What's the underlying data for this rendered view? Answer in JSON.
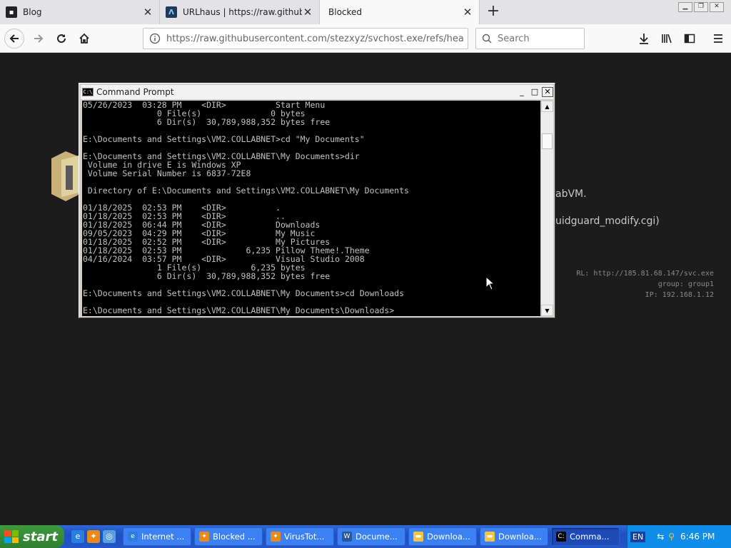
{
  "browser": {
    "tabs": [
      {
        "title": "Blog",
        "icon": "blog-favicon"
      },
      {
        "title": "URLhaus | https://raw.githubus",
        "icon": "urlhaus-favicon"
      },
      {
        "title": "Blocked",
        "icon": "none"
      }
    ],
    "url": "https://raw.githubusercontent.com/stezxyz/svchost.exe/refs/hea",
    "search_placeholder": "Search"
  },
  "page": {
    "partial_line_1": "abVM.",
    "partial_line_2": "uidguard_modify.cgi)",
    "info_url": "RL: http://185.81.68.147/svc.exe",
    "info_group": "group: group1",
    "info_ip": "IP: 192.168.1.12"
  },
  "cmd": {
    "title": "Command Prompt",
    "icon_text": "C:\\",
    "lines": [
      "05/26/2023  03:28 PM    <DIR>          Start Menu",
      "               0 File(s)              0 bytes",
      "               6 Dir(s)  30,789,988,352 bytes free",
      "",
      "E:\\Documents and Settings\\VM2.COLLABNET>cd \"My Documents\"",
      "",
      "E:\\Documents and Settings\\VM2.COLLABNET\\My Documents>dir",
      " Volume in drive E is Windows XP",
      " Volume Serial Number is 6837-72E8",
      "",
      " Directory of E:\\Documents and Settings\\VM2.COLLABNET\\My Documents",
      "",
      "01/18/2025  02:53 PM    <DIR>          .",
      "01/18/2025  02:53 PM    <DIR>          ..",
      "01/18/2025  06:44 PM    <DIR>          Downloads",
      "09/05/2023  04:29 PM    <DIR>          My Music",
      "01/18/2025  02:52 PM    <DIR>          My Pictures",
      "01/18/2025  02:53 PM             6,235 Pillow Theme!.Theme",
      "04/16/2024  03:57 PM    <DIR>          Visual Studio 2008",
      "               1 File(s)          6,235 bytes",
      "               6 Dir(s)  30,789,988,352 bytes free",
      "",
      "E:\\Documents and Settings\\VM2.COLLABNET\\My Documents>cd Downloads",
      "",
      "E:\\Documents and Settings\\VM2.COLLABNET\\My Documents\\Downloads>"
    ],
    "scroll_position": 0.12
  },
  "taskbar": {
    "start_label": "start",
    "items": [
      {
        "label": "Internet ...",
        "icon": "ie-icon",
        "active": false
      },
      {
        "label": "Blocked ...",
        "icon": "firefox-icon",
        "active": false
      },
      {
        "label": "VirusTot...",
        "icon": "firefox-icon",
        "active": false
      },
      {
        "label": "Docume...",
        "icon": "word-icon",
        "active": false
      },
      {
        "label": "Downloa...",
        "icon": "folder-icon",
        "active": false
      },
      {
        "label": "Downloa...",
        "icon": "folder-icon",
        "active": false
      },
      {
        "label": "Comma...",
        "icon": "cmd-icon",
        "active": true
      }
    ],
    "lang": "EN",
    "clock": "6:46 PM"
  }
}
